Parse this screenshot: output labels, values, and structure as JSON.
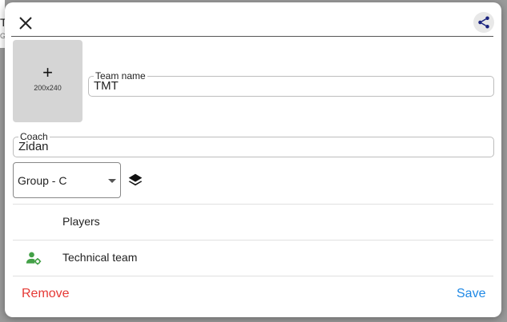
{
  "background": {
    "peek_title": "T",
    "peek_sub": "G"
  },
  "header": {
    "close_icon": "close-icon",
    "share_icon": "share-icon"
  },
  "image_placeholder": {
    "plus": "+",
    "size": "200x240"
  },
  "team_name": {
    "label": "Team name",
    "value": "TMT"
  },
  "coach": {
    "label": "Coach",
    "value": "Zidan"
  },
  "group_select": {
    "value": "Group - C"
  },
  "list": [
    {
      "label": "Players",
      "icon": ""
    },
    {
      "label": "Technical team",
      "icon": "user-gear-icon"
    }
  ],
  "footer": {
    "remove_label": "Remove",
    "save_label": "Save"
  },
  "colors": {
    "remove": "#e53935",
    "save": "#1e88e5",
    "tech_icon": "#43a047"
  }
}
